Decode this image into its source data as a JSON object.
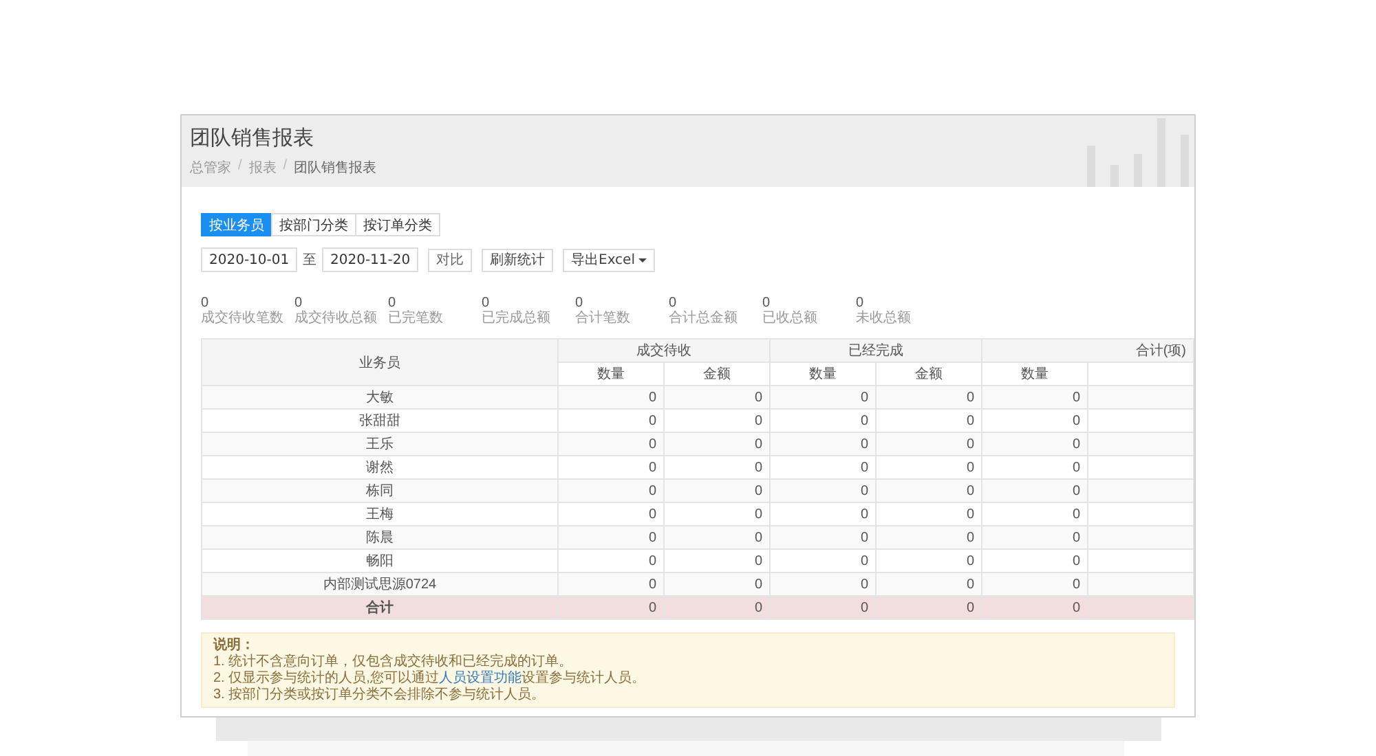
{
  "page": {
    "title": "团队销售报表",
    "breadcrumb_separator": "/",
    "breadcrumb": [
      {
        "label": "总管家",
        "current": false
      },
      {
        "label": "报表",
        "current": false
      },
      {
        "label": "团队销售报表",
        "current": true
      }
    ]
  },
  "tabs": [
    {
      "label": "按业务员",
      "selected": true
    },
    {
      "label": "按部门分类",
      "selected": false
    },
    {
      "label": "按订单分类",
      "selected": false
    }
  ],
  "filters": {
    "start_date": "2020-10-01",
    "separator": "至",
    "end_date": "2020-11-20",
    "buttons": [
      {
        "label": "对比",
        "kind": "small"
      },
      {
        "label": "刷新统计",
        "kind": "normal"
      },
      {
        "label": "导出Excel",
        "kind": "dropdown"
      }
    ]
  },
  "stats": [
    {
      "value": "0",
      "label": "成交待收笔数"
    },
    {
      "value": "0",
      "label": "成交待收总额"
    },
    {
      "value": "0",
      "label": "已完笔数"
    },
    {
      "value": "0",
      "label": "已完成总额"
    },
    {
      "value": "0",
      "label": "合计笔数"
    },
    {
      "value": "0",
      "label": "合计总金额"
    },
    {
      "value": "0",
      "label": "已收总额"
    },
    {
      "value": "0",
      "label": "未收总额"
    }
  ],
  "table": {
    "groups": [
      {
        "label": "业务员"
      },
      {
        "label": "成交待收",
        "columns": [
          "数量",
          "金额"
        ]
      },
      {
        "label": "已经完成",
        "columns": [
          "数量",
          "金额"
        ]
      },
      {
        "label": "合计(项)",
        "columns": [
          "数量"
        ]
      }
    ],
    "rows": [
      {
        "kind": "normal",
        "name": "大敏",
        "cells": [
          "0",
          "0",
          "0",
          "0",
          "0"
        ]
      },
      {
        "kind": "normal",
        "name": "张甜甜",
        "cells": [
          "0",
          "0",
          "0",
          "0",
          "0"
        ]
      },
      {
        "kind": "normal",
        "name": "王乐",
        "cells": [
          "0",
          "0",
          "0",
          "0",
          "0"
        ]
      },
      {
        "kind": "normal",
        "name": "谢然",
        "cells": [
          "0",
          "0",
          "0",
          "0",
          "0"
        ]
      },
      {
        "kind": "normal",
        "name": "栋同",
        "cells": [
          "0",
          "0",
          "0",
          "0",
          "0"
        ]
      },
      {
        "kind": "normal",
        "name": "王梅",
        "cells": [
          "0",
          "0",
          "0",
          "0",
          "0"
        ]
      },
      {
        "kind": "normal",
        "name": "陈晨",
        "cells": [
          "0",
          "0",
          "0",
          "0",
          "0"
        ]
      },
      {
        "kind": "normal",
        "name": "畅阳",
        "cells": [
          "0",
          "0",
          "0",
          "0",
          "0"
        ]
      },
      {
        "kind": "normal",
        "name": "内部测试思源0724",
        "cells": [
          "0",
          "0",
          "0",
          "0",
          "0"
        ]
      },
      {
        "kind": "total",
        "name": "合计",
        "cells": [
          "0",
          "0",
          "0",
          "0",
          "0"
        ]
      }
    ]
  },
  "notes": {
    "title": "说明：",
    "lines": [
      {
        "text": "1. 统计不含意向订单，仅包含成交待收和已经完成的订单。"
      },
      {
        "text": "2. 仅显示参与统计的人员,您可以通过",
        "link": "人员设置功能",
        "after": "设置参与统计人员。"
      },
      {
        "text": "3. 按部门分类或按订单分类不会排除不参与统计人员。"
      }
    ]
  }
}
